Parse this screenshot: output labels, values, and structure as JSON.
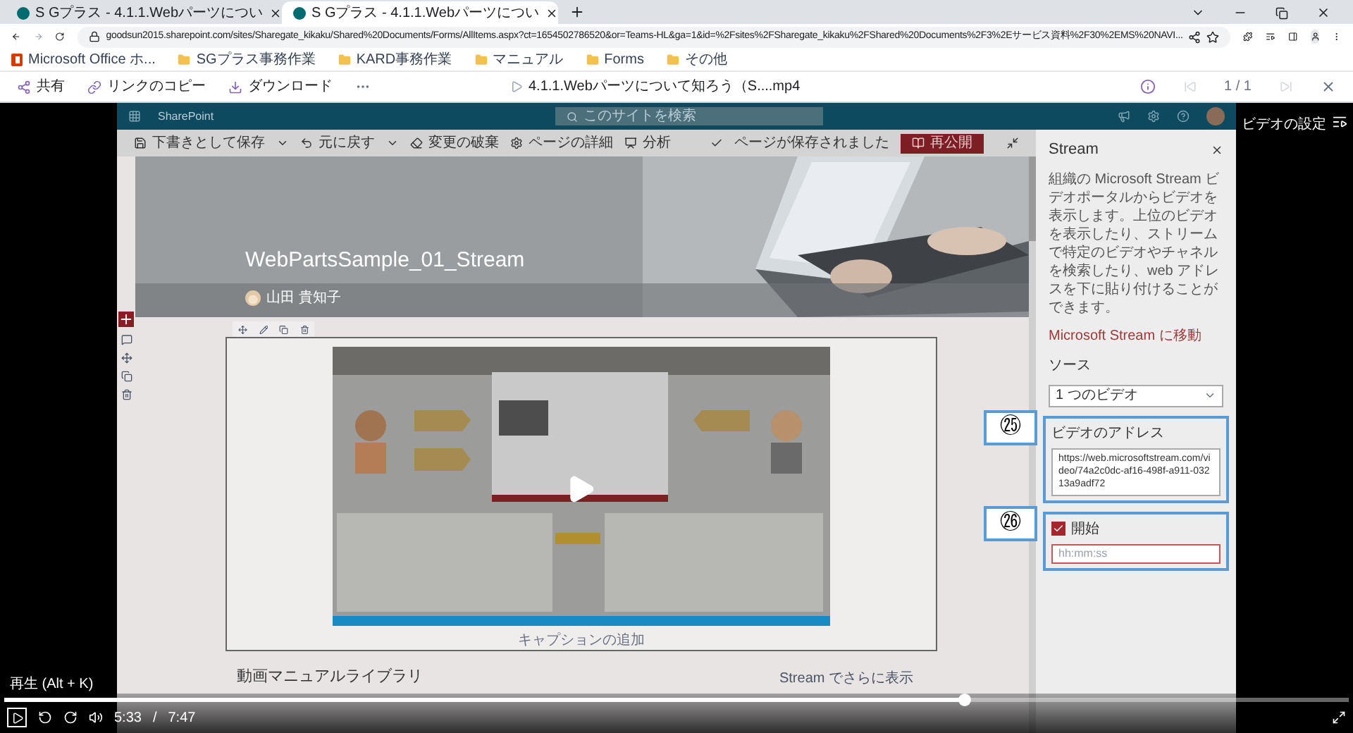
{
  "browser": {
    "tabs": [
      {
        "title": "S Gプラス - 4.1.1.Webパーツについ",
        "selected": false
      },
      {
        "title": "S Gプラス - 4.1.1.Webパーツについ",
        "selected": true
      }
    ],
    "address": "goodsun2015.sharepoint.com/sites/Sharegate_kikaku/Shared%20Documents/Forms/AllItems.aspx?ct=1654502786520&or=Teams-HL&ga=1&id=%2Fsites%2FSharegate_kikaku%2FShared%20Documents%2F3%2Eサービス資料%2F30%2EMS%20NAVI...",
    "bookmarks": [
      {
        "label": "Microsoft Office ホ...",
        "kind": "office"
      },
      {
        "label": "SGプラス事務作業",
        "kind": "folder"
      },
      {
        "label": "KARD事務作業",
        "kind": "folder"
      },
      {
        "label": "マニュアル",
        "kind": "folder"
      },
      {
        "label": "Forms",
        "kind": "folder"
      },
      {
        "label": "その他",
        "kind": "folder"
      }
    ]
  },
  "viewer_toolbar": {
    "actions": [
      "共有",
      "リンクのコピー",
      "ダウンロード"
    ],
    "file_name": "4.1.1.Webパーツについて知ろう（S....mp4",
    "page": "1 / 1"
  },
  "video_settings_label": "ビデオの設定",
  "recording": {
    "app_name": "SharePoint",
    "search": {
      "placeholder": "このサイトを検索"
    },
    "command_bar": {
      "items": [
        "下書きとして保存",
        "元に戻す",
        "変更の破棄",
        "ページの詳細",
        "分析"
      ],
      "status": "ページが保存されました",
      "publish_button": "再公開"
    },
    "hero": {
      "title": "WebPartsSample_01_Stream",
      "author": "山田 貴知子"
    },
    "video_webpart": {
      "caption": "キャプションの追加"
    },
    "section": {
      "title": "動画マニュアルライブラリ",
      "link": "Stream でさらに表示"
    },
    "panel": {
      "title": "Stream",
      "description": "組織の Microsoft Stream ビデオポータルからビデオを表示します。上位のビデオを表示したり、ストリームで特定のビデオやチャネルを検索したり、web アドレスを下に貼り付けることができます。",
      "link": "Microsoft Stream に移動",
      "source_label": "ソース",
      "source_value": "1 つのビデオ",
      "address_label": "ビデオのアドレス",
      "address_value": "https://web.microsoftstream.com/video/74a2c0dc-af16-498f-a911-03213a9adf72",
      "start": {
        "label": "開始",
        "checked": true
      },
      "start_time": {
        "placeholder": "hh:mm:ss"
      }
    }
  },
  "annotations": [
    "㉕",
    "㉖"
  ],
  "player": {
    "tooltip": "再生 (Alt + K)",
    "current_time": "5:33",
    "separator": "/",
    "duration": "7:47",
    "level": 0.714
  }
}
